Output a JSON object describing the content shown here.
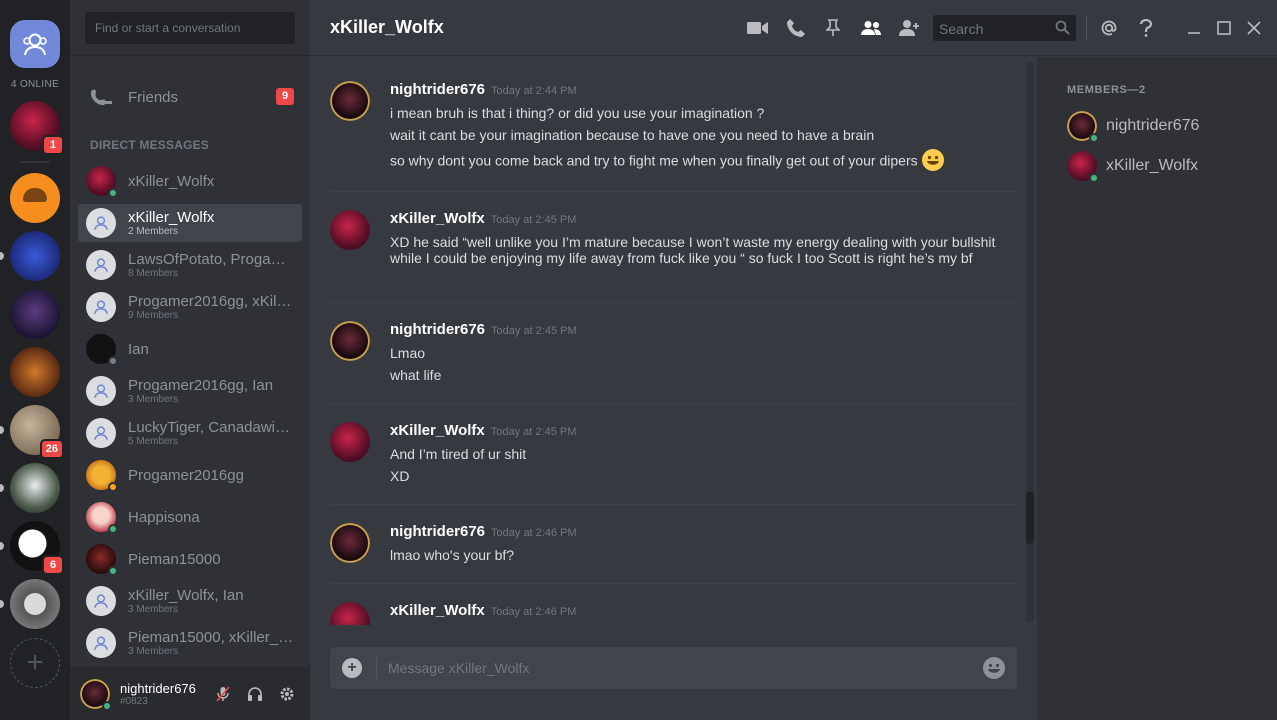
{
  "colors": {
    "brand": "#7289da",
    "online": "#43b581",
    "idle": "#faa61a",
    "offline": "#747f8d",
    "badge": "#f04747"
  },
  "guild_bar": {
    "online_count": "4 ONLINE",
    "guilds": [
      {
        "name": "guild-1",
        "badge": "1"
      },
      {
        "name": "guild-the-shit-show",
        "badge": ""
      },
      {
        "name": "guild-holy-karp",
        "badge": ""
      },
      {
        "name": "guild-4",
        "badge": ""
      },
      {
        "name": "guild-league",
        "badge": ""
      },
      {
        "name": "guild-6",
        "badge": "26"
      },
      {
        "name": "guild-7",
        "badge": ""
      },
      {
        "name": "guild-8",
        "badge": "6"
      },
      {
        "name": "guild-9",
        "badge": ""
      }
    ],
    "add_label": "+"
  },
  "sidebar": {
    "search_placeholder": "Find or start a conversation",
    "friends_label": "Friends",
    "friends_badge": "9",
    "dm_header": "DIRECT MESSAGES",
    "dms": [
      {
        "name": "xKiller_Wolfx",
        "sub": "",
        "status": "online"
      },
      {
        "name": "xKiller_Wolfx",
        "sub": "2 Members",
        "status": ""
      },
      {
        "name": "LawsOfPotato, Progame...",
        "sub": "8 Members",
        "status": ""
      },
      {
        "name": "Progamer2016gg, xKille...",
        "sub": "9 Members",
        "status": ""
      },
      {
        "name": "Ian",
        "sub": "",
        "status": "offline"
      },
      {
        "name": "Progamer2016gg, Ian",
        "sub": "3 Members",
        "status": ""
      },
      {
        "name": "LuckyTiger, Canadawize...",
        "sub": "5 Members",
        "status": ""
      },
      {
        "name": "Progamer2016gg",
        "sub": "",
        "status": "idle"
      },
      {
        "name": "Happisona",
        "sub": "",
        "status": "online"
      },
      {
        "name": "Pieman15000",
        "sub": "",
        "status": "online"
      },
      {
        "name": "xKiller_Wolfx, Ian",
        "sub": "3 Members",
        "status": ""
      },
      {
        "name": "Pieman15000, xKiller_W...",
        "sub": "3 Members",
        "status": ""
      }
    ],
    "user": {
      "name": "nightrider676",
      "tag": "#0823"
    }
  },
  "header": {
    "title": "xKiller_Wolfx",
    "search_placeholder": "Search"
  },
  "messages": [
    {
      "author": "nightrider676",
      "time": "Today at 2:44 PM",
      "lines": [
        "i mean bruh is that i thing? or did you use your imagination ?",
        "wait it cant be your imagination because to have one you need to have a brain",
        "so why dont you come back and try to fight me when you finally get out of your dipers"
      ]
    },
    {
      "author": "xKiller_Wolfx",
      "time": "Today at 2:45 PM",
      "lines": [
        "XD he said “well unlike you I’m mature because I won’t waste my energy dealing with your bullshit while I could be enjoying my life away from fuck like you “ so fuck I too Scott is right he’s my bf"
      ]
    },
    {
      "author": "nightrider676",
      "time": "Today at 2:45 PM",
      "lines": [
        "Lmao",
        "what life"
      ]
    },
    {
      "author": "xKiller_Wolfx",
      "time": "Today at 2:45 PM",
      "lines": [
        "And I’m tired of ur shit",
        "XD"
      ]
    },
    {
      "author": "nightrider676",
      "time": "Today at 2:46 PM",
      "lines": [
        "lmao who's your bf?"
      ]
    },
    {
      "author": "xKiller_Wolfx",
      "time": "Today at 2:46 PM",
      "lines": []
    }
  ],
  "composer": {
    "placeholder": "Message xKiller_Wolfx"
  },
  "members": {
    "header": "MEMBERS—2",
    "list": [
      {
        "name": "nightrider676",
        "status": "online"
      },
      {
        "name": "xKiller_Wolfx",
        "status": "online"
      }
    ]
  }
}
